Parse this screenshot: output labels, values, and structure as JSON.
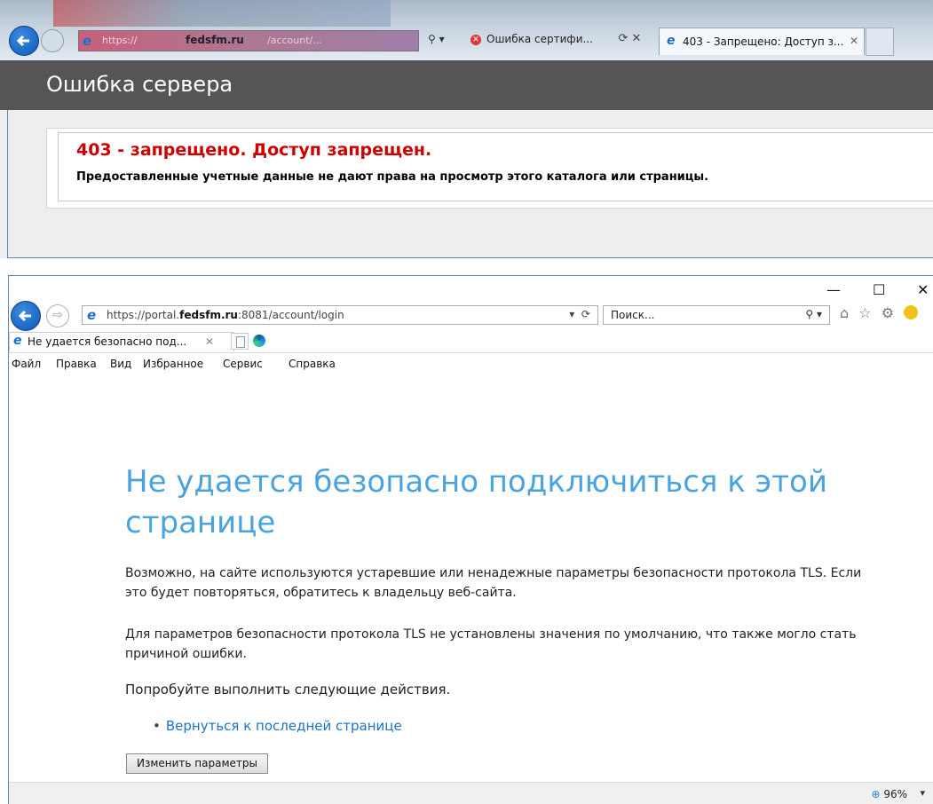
{
  "top_window": {
    "address_partial": "https://",
    "address_domain": "fedsfm.ru",
    "address_path": "/account/...",
    "cert_error_label": "Ошибка сертифи...",
    "tab_title": "403 - Запрещено: Доступ з...",
    "header_title": "Ошибка сервера",
    "error_heading": "403 - запрещено. Доступ запрещен.",
    "error_text": "Предоставленные учетные данные не дают права на просмотр этого каталога или страницы."
  },
  "bottom_window": {
    "address_url_prefix": "https://portal.",
    "address_url_domain": "fedsfm.ru",
    "address_url_suffix": ":8081/account/login",
    "search_placeholder": "Поиск...",
    "tab_title": "Не удается безопасно под...",
    "menu": [
      "Файл",
      "Правка",
      "Вид",
      "Избранное",
      "Сервис",
      "Справка"
    ],
    "page_heading": "Не удается безопасно подключиться к этой странице",
    "para1": "Возможно, на сайте используются устаревшие или ненадежные параметры безопасности протокола TLS. Если это будет повторяться, обратитесь к владельцу веб-сайта.",
    "para2": "Для параметров безопасности протокола TLS не установлены значения по умолчанию, что также могло стать причиной ошибки.",
    "try_text": "Попробуйте выполнить следующие действия.",
    "back_link": "Вернуться к последней странице",
    "settings_button": "Изменить параметры",
    "zoom": "96%"
  },
  "icons": {
    "back": "back-arrow-icon",
    "forward": "forward-arrow-icon",
    "ie": "ie-logo-icon",
    "refresh": "refresh-icon",
    "search": "search-icon",
    "home": "home-icon",
    "favorites": "star-icon",
    "tools": "gear-icon",
    "feedback": "smiley-icon",
    "close": "close-icon",
    "minimize": "minimize-icon",
    "maximize": "maximize-icon",
    "zoom": "zoom-icon"
  },
  "colors": {
    "error_red": "#cc0000",
    "header_gray": "#555555",
    "heading_blue": "#4aa3df",
    "link_blue": "#1a73c8"
  }
}
